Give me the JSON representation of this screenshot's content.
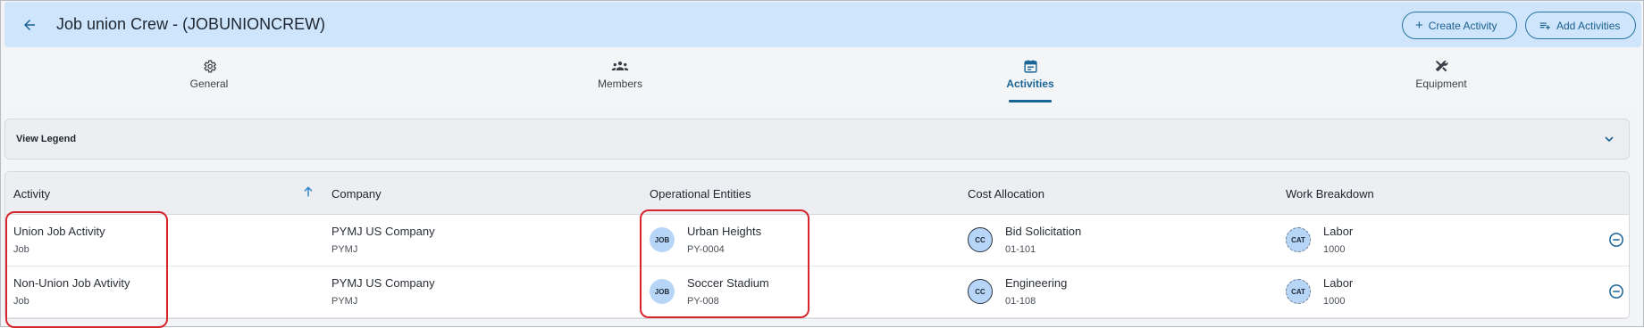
{
  "header": {
    "title": "Job union Crew - (JOBUNIONCREW)",
    "back_icon": "arrow-left-icon",
    "create_activity_label": "Create Activity",
    "add_activities_label": "Add Activities",
    "bg_color": "#cfe5fb",
    "accent_color": "#1a6496"
  },
  "tabs": [
    {
      "label": "General",
      "icon": "gear-icon",
      "active": false
    },
    {
      "label": "Members",
      "icon": "people-icon",
      "active": false
    },
    {
      "label": "Activities",
      "icon": "calendar-icon",
      "active": true
    },
    {
      "label": "Equipment",
      "icon": "tools-icon",
      "active": false
    }
  ],
  "legend": {
    "label": "View Legend",
    "icon": "chevron-down-icon"
  },
  "table": {
    "columns": [
      "Activity",
      "Company",
      "Operational Entities",
      "Cost Allocation",
      "Work Breakdown"
    ],
    "sort_column": "Activity",
    "sort_direction": "ascending",
    "rows": [
      {
        "activity": "Union Job Activity",
        "activity_type": "Job",
        "company": "PYMJ US Company",
        "company_code": "PYMJ",
        "entity_badge": "JOB",
        "entity_name": "Urban Heights",
        "entity_code": "PY-0004",
        "cost_badge": "CC",
        "cost_name": "Bid Solicitation",
        "cost_code": "01-101",
        "wb_badge": "CAT",
        "wb_name": "Labor",
        "wb_code": "1000"
      },
      {
        "activity": "Non-Union Job Avtivity",
        "activity_type": "Job",
        "company": "PYMJ US Company",
        "company_code": "PYMJ",
        "entity_badge": "JOB",
        "entity_name": "Soccer Stadium",
        "entity_code": "PY-008",
        "cost_badge": "CC",
        "cost_name": "Engineering",
        "cost_code": "01-108",
        "wb_badge": "CAT",
        "wb_name": "Labor",
        "wb_code": "1000"
      }
    ]
  },
  "highlight_color": "#d7262e"
}
